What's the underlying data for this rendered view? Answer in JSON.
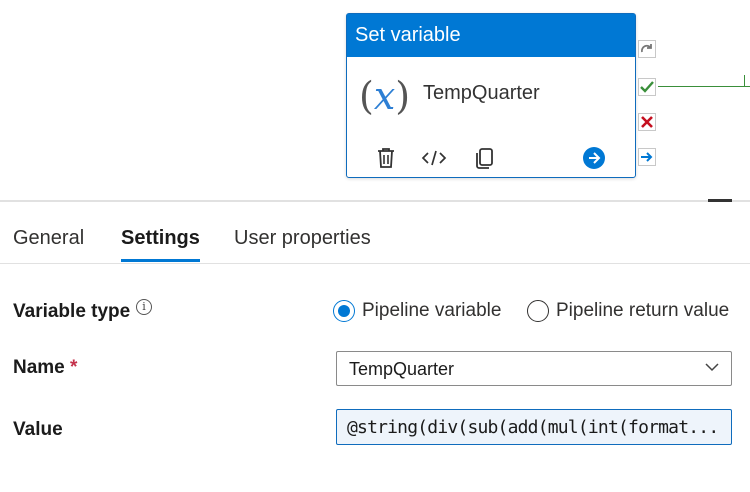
{
  "activity": {
    "title": "Set variable",
    "icon_text_open": "(",
    "icon_text_var": "x",
    "icon_text_close": ")",
    "name": "TempQuarter",
    "actions": [
      "trash-icon",
      "code-icon",
      "copy-icon",
      "arrow-right-circle-icon"
    ],
    "ports": [
      "skip-icon",
      "success-check-icon",
      "failure-x-icon",
      "completion-arrow-icon"
    ],
    "colors": {
      "header": "#0078d4",
      "success": "#3a8f3a",
      "failure": "#c50f1f"
    }
  },
  "tabs": [
    {
      "label": "General",
      "active": false
    },
    {
      "label": "Settings",
      "active": true
    },
    {
      "label": "User properties",
      "active": false
    }
  ],
  "settings": {
    "variable_type": {
      "label": "Variable type",
      "info_icon": "i",
      "options": [
        {
          "label": "Pipeline variable",
          "selected": true
        },
        {
          "label": "Pipeline return value",
          "selected": false
        }
      ]
    },
    "name": {
      "label": "Name",
      "required_mark": "*",
      "value": "TempQuarter"
    },
    "value": {
      "label": "Value",
      "text": "@string(div(sub(add(mul(int(format..."
    }
  },
  "accent": "#0078d4"
}
